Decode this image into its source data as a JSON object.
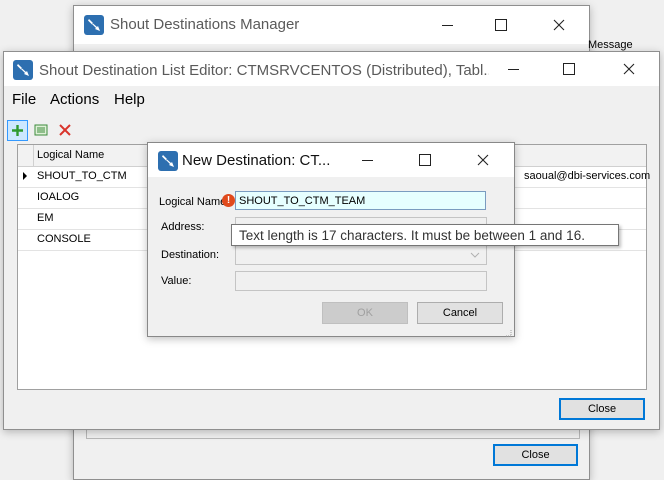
{
  "back_window": {
    "title": "Shout Destinations Manager",
    "column_header": "Message",
    "close_label": "Close"
  },
  "editor_window": {
    "title": "Shout Destination List Editor: CTMSRVCENTOS (Distributed), Tabl...",
    "menu": [
      "File",
      "Actions",
      "Help"
    ],
    "toolbar": [
      "add-icon",
      "list-icon",
      "delete-icon"
    ],
    "grid": {
      "header_logical_name": "Logical Name",
      "rows": [
        "SHOUT_TO_CTM",
        "IOALOG",
        "EM",
        "CONSOLE"
      ],
      "first_row_extra": "saoual@dbi-services.com"
    },
    "close_label": "Close"
  },
  "dialog": {
    "title": "New Destination: CT...",
    "labels": {
      "logical_name": "Logical Name",
      "address": "Address:",
      "destination": "Destination:",
      "value": "Value:"
    },
    "logical_name_value": "SHOUT_TO_CTM_TEAM",
    "ok_label": "OK",
    "cancel_label": "Cancel",
    "tooltip": "Text length is 17 characters. It must be between 1 and 16.",
    "error_icon": "warning-circle-icon",
    "colors": {
      "input_bg": "#e6ffff",
      "error": "#e04a1c"
    }
  }
}
